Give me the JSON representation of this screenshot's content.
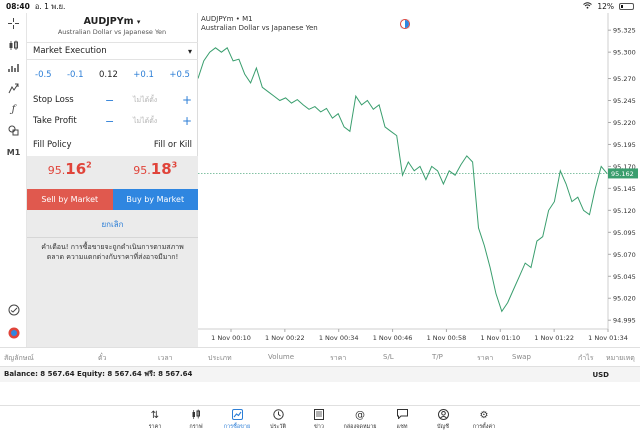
{
  "status": {
    "time": "08:40",
    "date": "อ. 1 พ.ย.",
    "battery": "12%"
  },
  "symbol": {
    "name": "AUDJPYm",
    "description": "Australian Dollar vs Japanese Yen"
  },
  "order": {
    "execution": "Market Execution",
    "volume_steps": [
      "-0.5",
      "-0.1",
      "0.12",
      "+0.1",
      "+0.5"
    ],
    "stop_loss_label": "Stop Loss",
    "take_profit_label": "Take Profit",
    "not_set": "ไม่ได้ตั้ง",
    "fill_policy_label": "Fill Policy",
    "fill_policy_value": "Fill or Kill",
    "bid": {
      "big": "95.",
      "pips": "16",
      "point": "2"
    },
    "ask": {
      "big": "95.",
      "pips": "18",
      "point": "3"
    },
    "sell_label": "Sell by Market",
    "buy_label": "Buy by Market",
    "cancel_label": "ยกเลิก",
    "warning": "คำเตือน! การซื้อขายจะถูกดำเนินการตามสภาพตลาด ความแตกต่างกับราคาที่ส่งอาจมีมาก!"
  },
  "chart_title": {
    "symbol": "AUDJPYm • M1",
    "description": "Australian Dollar vs Japanese Yen"
  },
  "chart_data": {
    "type": "line",
    "color": "#3a9e6e",
    "x": [
      "1 Nov 00:10",
      "1 Nov 00:22",
      "1 Nov 00:34",
      "1 Nov 00:46",
      "1 Nov 00:58",
      "1 Nov 01:10",
      "1 Nov 01:22",
      "1 Nov 01:34"
    ],
    "y_ticks": [
      95.325,
      95.3,
      95.27,
      95.245,
      95.22,
      95.195,
      95.17,
      95.145,
      95.12,
      95.095,
      95.07,
      95.045,
      95.02,
      94.995
    ],
    "ylim": [
      94.985,
      95.34
    ],
    "current_price": 95.162,
    "current_price_label": "95.162",
    "values": [
      95.27,
      95.29,
      95.3,
      95.305,
      95.3,
      95.305,
      95.29,
      95.292,
      95.275,
      95.265,
      95.282,
      95.26,
      95.255,
      95.25,
      95.245,
      95.248,
      95.242,
      95.246,
      95.24,
      95.235,
      95.238,
      95.232,
      95.236,
      95.225,
      95.23,
      95.215,
      95.21,
      95.25,
      95.24,
      95.245,
      95.235,
      95.24,
      95.215,
      95.21,
      95.205,
      95.16,
      95.175,
      95.165,
      95.17,
      95.155,
      95.17,
      95.165,
      95.15,
      95.165,
      95.16,
      95.172,
      95.182,
      95.175,
      95.1,
      95.08,
      95.055,
      95.025,
      95.005,
      95.015,
      95.03,
      95.045,
      95.06,
      95.055,
      95.085,
      95.09,
      95.12,
      95.13,
      95.165,
      95.15,
      95.13,
      95.135,
      95.12,
      95.115,
      95.145,
      95.17,
      95.162
    ]
  },
  "table_headers": [
    "สัญลักษณ์",
    "ตั๋ว",
    "เวลา",
    "ประเภท",
    "Volume",
    "ราคา",
    "S/L",
    "T/P",
    "ราคา",
    "Swap",
    "กำไร",
    "หมายเหตุ"
  ],
  "balance": {
    "text": "Balance: 8 567.64  Equity: 8 567.64  ฟรี: 8 567.64",
    "currency": "USD"
  },
  "tabs": [
    {
      "label": "ราคา",
      "icon": "quotes-icon"
    },
    {
      "label": "กราฟ",
      "icon": "chart-icon"
    },
    {
      "label": "การซื้อขาย",
      "icon": "trade-icon"
    },
    {
      "label": "ประวัติ",
      "icon": "history-icon"
    },
    {
      "label": "ข่าว",
      "icon": "news-icon"
    },
    {
      "label": "กล่องจดหมาย",
      "icon": "mailbox-icon"
    },
    {
      "label": "แชท",
      "icon": "chat-icon"
    },
    {
      "label": "บัญชี",
      "icon": "account-icon"
    },
    {
      "label": "การตั้งค่า",
      "icon": "settings-icon"
    }
  ],
  "timeframe": "M1"
}
